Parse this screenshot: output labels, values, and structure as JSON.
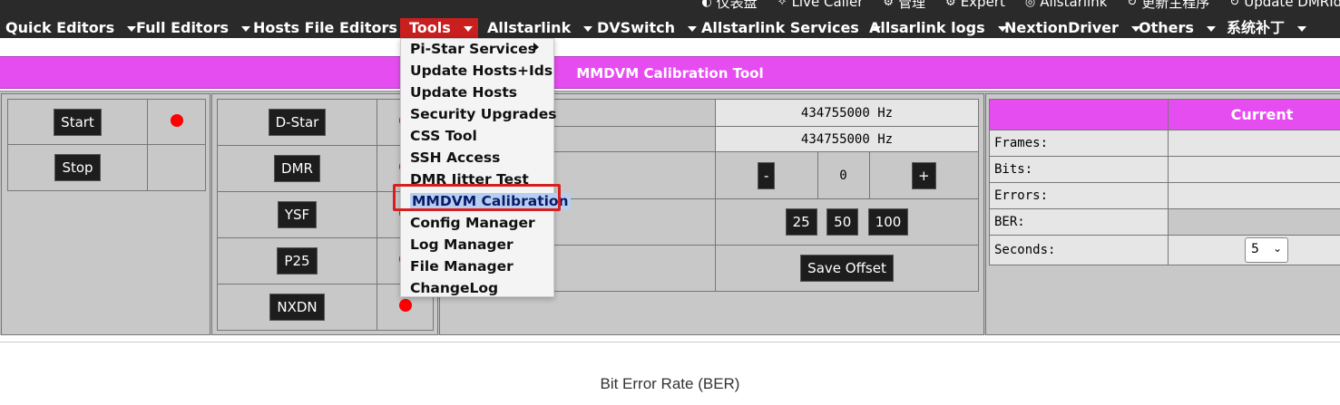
{
  "top_links": [
    {
      "icon": "dashboard-icon",
      "label": "仪表盘"
    },
    {
      "icon": "live-caller-icon",
      "label": "Live Caller"
    },
    {
      "icon": "admin-icon",
      "label": "管理"
    },
    {
      "icon": "expert-icon",
      "label": "Expert"
    },
    {
      "icon": "allstarlink-icon",
      "label": "Allstarlink"
    },
    {
      "icon": "update-icon",
      "label": "更新主程序"
    },
    {
      "icon": "update-dmrids-icon",
      "label": "Update DMRIds"
    }
  ],
  "nav": {
    "items": [
      {
        "label": "Quick Editors"
      },
      {
        "label": "Full Editors"
      },
      {
        "label": "Hosts File Editors"
      },
      {
        "label": "Tools"
      },
      {
        "label": "Allstarlink"
      },
      {
        "label": "DVSwitch"
      },
      {
        "label": "Allstarlink Services"
      },
      {
        "label": "Allsarlink logs"
      },
      {
        "label": "NextionDriver"
      },
      {
        "label": "Others"
      },
      {
        "label": "系统补丁"
      }
    ],
    "active_index": 3
  },
  "title_bar": {
    "text": "MMDVM Calibration Tool",
    "color": "#e64df0"
  },
  "controls": {
    "start": "Start",
    "stop": "Stop"
  },
  "modes": [
    "D-Star",
    "DMR",
    "YSF",
    "P25",
    "NXDN"
  ],
  "frequency": {
    "rx": "434755000 Hz",
    "tx": "434755000 Hz",
    "minus": "-",
    "offset": "0",
    "plus": "+",
    "steps": [
      "25",
      "50",
      "100"
    ],
    "save": "Save Offset"
  },
  "status": {
    "header_current": "Current",
    "rows": [
      {
        "label": "Frames:",
        "value": ""
      },
      {
        "label": "Bits:",
        "value": ""
      },
      {
        "label": "Errors:",
        "value": ""
      },
      {
        "label": "BER:",
        "value": ""
      }
    ],
    "seconds_label": "Seconds:",
    "seconds_value": "5"
  },
  "tools_menu": {
    "items": [
      "Pi-Star Services",
      "Update Hosts+Ids",
      "Update Hosts",
      "Security Upgrades",
      "CSS Tool",
      "SSH Access",
      "DMR Jitter Test",
      "MMDVM Calibration",
      "Config Manager",
      "Log Manager",
      "File Manager",
      "ChangeLog"
    ],
    "highlighted_index": 7
  },
  "chart": {
    "title": "Bit Error Rate (BER)"
  },
  "colors": {
    "accent": "#e64df0",
    "active_nav": "#c91f1f",
    "indicator": "#ff0000",
    "highlight_box": "#d81f1f"
  }
}
